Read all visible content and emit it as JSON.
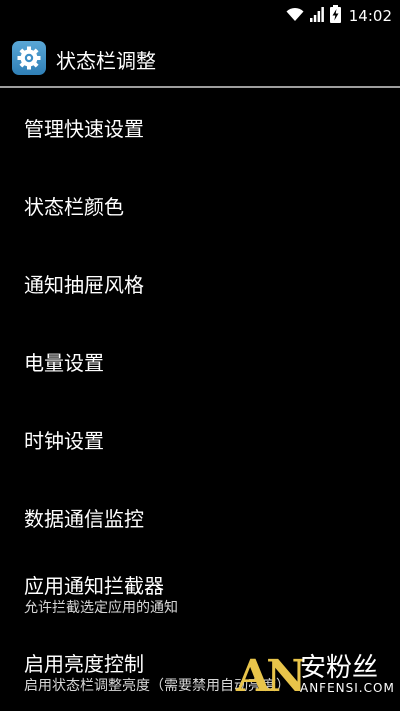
{
  "status_bar": {
    "time": "14:02",
    "icons": [
      "wifi-icon",
      "signal-icon",
      "battery-charging-icon"
    ]
  },
  "action_bar": {
    "app_icon": "gear-icon",
    "title": "状态栏调整"
  },
  "menu": {
    "items": [
      {
        "title": "管理快速设置"
      },
      {
        "title": "状态栏颜色"
      },
      {
        "title": "通知抽屉风格"
      },
      {
        "title": "电量设置"
      },
      {
        "title": "时钟设置"
      },
      {
        "title": "数据通信监控"
      },
      {
        "title": "应用通知拦截器",
        "summary": "允许拦截选定应用的通知"
      },
      {
        "title": "启用亮度控制",
        "summary": "启用状态栏调整亮度（需要禁用自动亮度）"
      }
    ]
  },
  "watermark": {
    "logo": "AN",
    "name_cn": "安粉丝",
    "name_en": "ANFENSI.COM"
  },
  "colors": {
    "background": "#000000",
    "divider": "#9e9e9e",
    "text": "#ffffff",
    "summary_text": "#d8d8d8",
    "app_icon": "#3d8fc7",
    "watermark_logo": "#e8c44a"
  }
}
